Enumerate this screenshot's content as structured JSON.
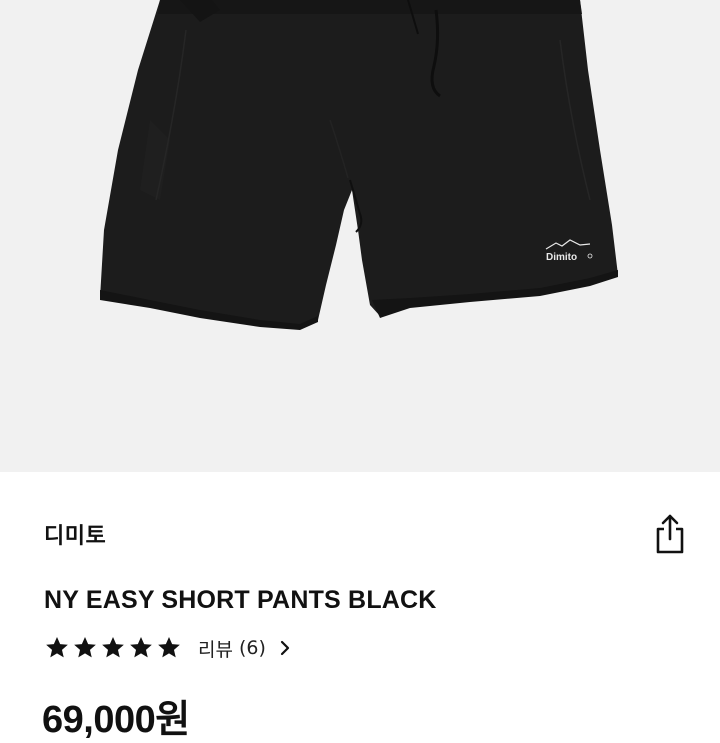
{
  "product": {
    "image_logo_text": "Dimito",
    "brand": "디미토",
    "name": "NY EASY SHORT PANTS BLACK",
    "rating": {
      "stars_filled": 5,
      "stars_total": 5,
      "review_label": "리뷰",
      "review_count": "(6)"
    },
    "price": "69,000원"
  },
  "icons": {
    "share": "share-icon",
    "star": "star-icon",
    "chevron": "chevron-right-icon"
  },
  "colors": {
    "image_background": "#f1f1f1",
    "shorts": "#1c1c1c",
    "star": "#111111",
    "text": "#111111"
  }
}
